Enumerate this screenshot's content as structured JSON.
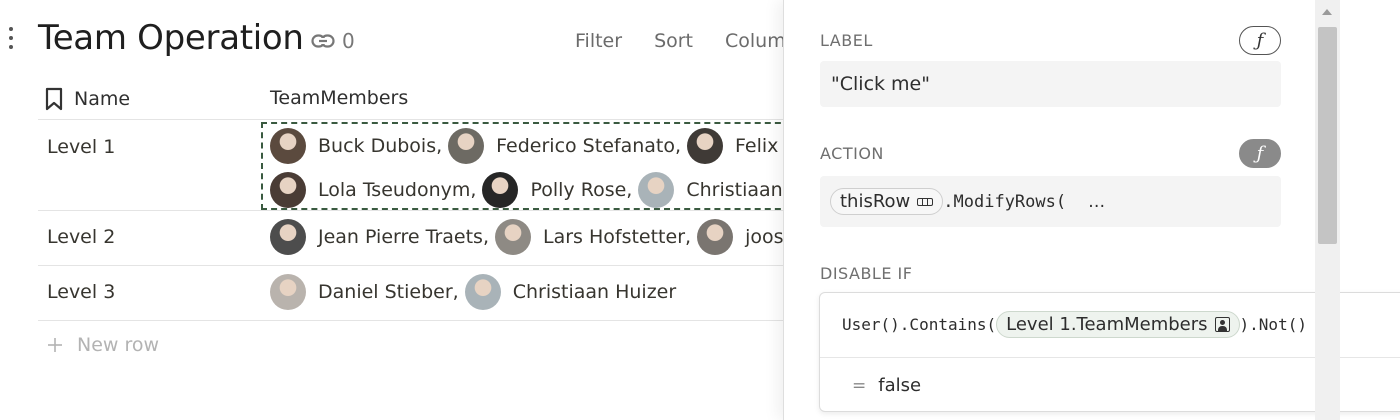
{
  "page": {
    "title": "Team Operation",
    "link_count": "0",
    "icons": {
      "drag": "drag-handle-icon",
      "link": "link-icon",
      "bookmark": "bookmark-icon",
      "plus": "plus-icon"
    }
  },
  "toolbar": {
    "filter": "Filter",
    "sort": "Sort",
    "columns": "Colum"
  },
  "table": {
    "columns": {
      "name": "Name",
      "team_members": "TeamMembers"
    },
    "rows": [
      {
        "name": "Level 1",
        "lines": [
          [
            {
              "name": "Buck Dubois",
              "sep": ",",
              "color": "#5b4a3e"
            },
            {
              "name": "Federico Stefanato",
              "sep": ",",
              "color": "#6d6a63"
            },
            {
              "name": "Felix M",
              "sep": "",
              "color": "#3f3a36"
            }
          ],
          [
            {
              "name": "Lola Tseudonym",
              "sep": ",",
              "color": "#4a3c35"
            },
            {
              "name": "Polly Rose",
              "sep": ",",
              "color": "#262626"
            },
            {
              "name": "Christiaan H",
              "sep": "",
              "color": "#a9b3b8"
            }
          ]
        ]
      },
      {
        "name": "Level 2",
        "lines": [
          [
            {
              "name": "Jean Pierre Traets",
              "sep": ",",
              "color": "#4d4d4d"
            },
            {
              "name": "Lars Hofstetter",
              "sep": ",",
              "color": "#8e8a84"
            },
            {
              "name": "joost r",
              "sep": "",
              "color": "#7a7570"
            }
          ]
        ]
      },
      {
        "name": "Level 3",
        "lines": [
          [
            {
              "name": "Daniel Stieber",
              "sep": ",",
              "color": "#b9b3ad"
            },
            {
              "name": "Christiaan Huizer",
              "sep": "",
              "color": "#a9b3b8"
            }
          ]
        ]
      }
    ],
    "new_row": "New row"
  },
  "panel": {
    "label": {
      "heading": "LABEL",
      "value": "\"Click me\"",
      "fx": "ƒ"
    },
    "action": {
      "heading": "ACTION",
      "chip": "thisRow",
      "code": ".ModifyRows(",
      "ellipsis": "…",
      "fx": "ƒ"
    },
    "disable_if": {
      "heading": "DISABLE IF",
      "prefix": "User().Contains(",
      "chip": "Level 1.TeamMembers",
      "suffix": ").Not()",
      "eq": "=",
      "result": "false"
    }
  }
}
